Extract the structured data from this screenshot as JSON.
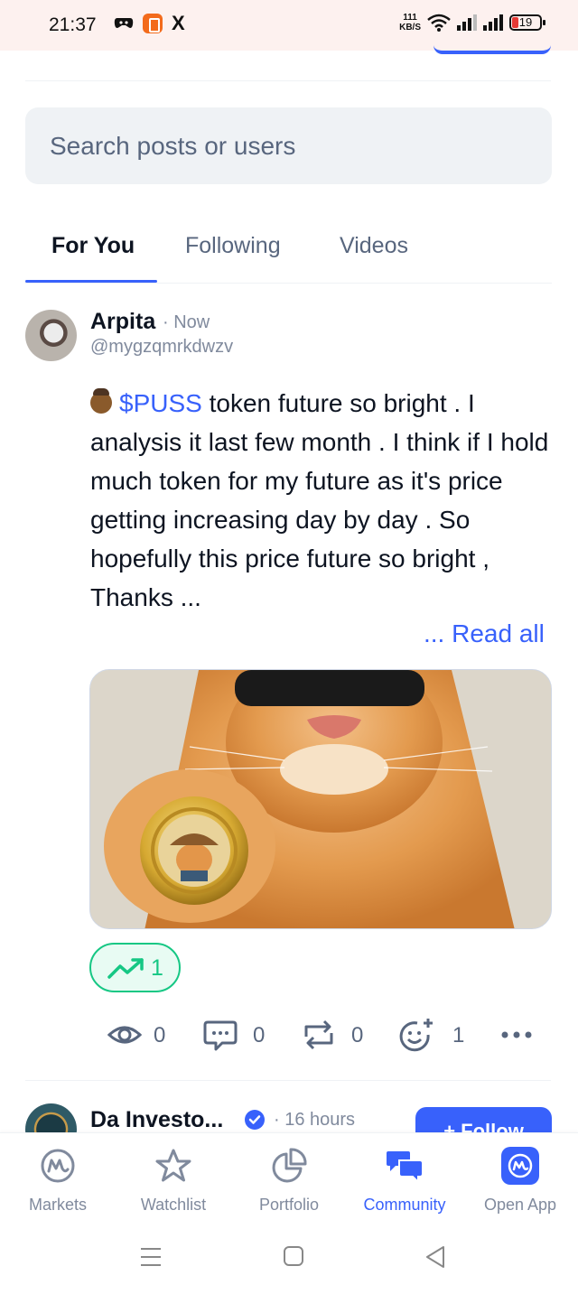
{
  "status_bar": {
    "time": "21:37",
    "x_logo": "X",
    "net_speed_value": "111",
    "net_speed_unit": "KB/S",
    "battery": "19",
    "icons": [
      "discord-like-game-icon",
      "orange-app-icon",
      "x-icon",
      "wifi-icon",
      "signal-icon",
      "signal-icon",
      "battery-icon"
    ]
  },
  "search": {
    "placeholder": "Search posts or users"
  },
  "tabs": [
    {
      "label": "For You",
      "active": true
    },
    {
      "label": "Following",
      "active": false
    },
    {
      "label": "Videos",
      "active": false
    }
  ],
  "post": {
    "author": "Arpita",
    "time": "· Now",
    "handle": "@mygzqmrkdwzv",
    "ticker": "$PUSS",
    "text": " token future so bright . I analysis it last few month . I think if I hold much token for my future as it's price getting increasing day by day . So hopefully this price future so bright , Thanks ...",
    "read_all": "... Read all",
    "trend_count": "1",
    "actions": {
      "views": "0",
      "comments": "0",
      "reposts": "0",
      "reactions": "1"
    }
  },
  "next_post": {
    "author": "Da Investo...",
    "time": "· 16 hours",
    "follow_label": "+ Follow"
  },
  "bottom_nav": [
    {
      "label": "Markets",
      "icon": "markets-icon",
      "active": false
    },
    {
      "label": "Watchlist",
      "icon": "star-icon",
      "active": false
    },
    {
      "label": "Portfolio",
      "icon": "pie-chart-icon",
      "active": false
    },
    {
      "label": "Community",
      "icon": "chat-bubbles-icon",
      "active": true
    },
    {
      "label": "Open App",
      "icon": "app-logo-icon",
      "active": false
    }
  ],
  "colors": {
    "accent": "#3861fb",
    "green": "#16c784",
    "muted": "#58667e"
  }
}
